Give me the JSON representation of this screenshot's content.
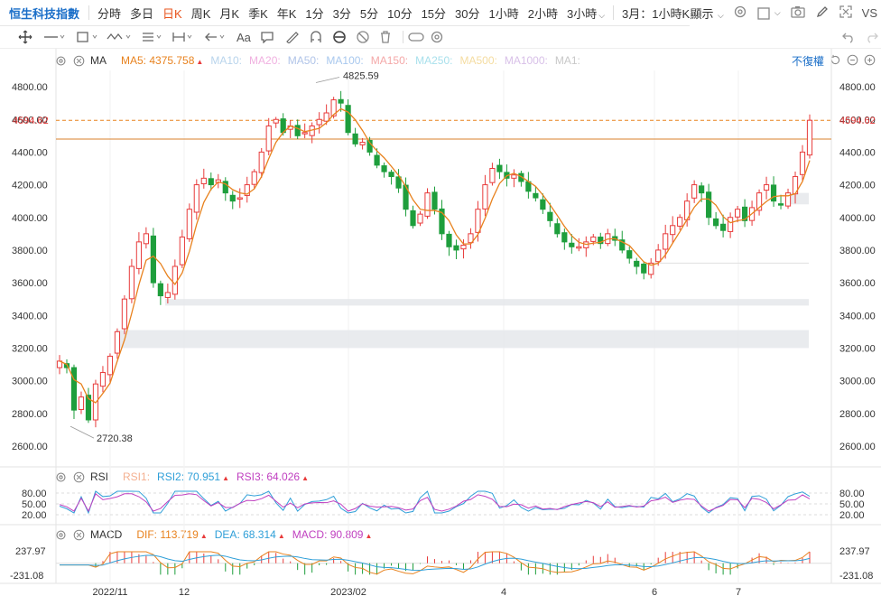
{
  "timeframe_bar": {
    "title": "恒生科技指數",
    "items": [
      "分時",
      "多日",
      "日K",
      "周K",
      "月K",
      "季K",
      "年K",
      "1分",
      "3分",
      "5分",
      "10分",
      "15分",
      "30分",
      "1小時",
      "2小時",
      "3小時"
    ],
    "active": "日K",
    "range_select": "3月：1小時K",
    "display_label": "顯示",
    "vs_label": "VS"
  },
  "main_panel": {
    "indicator": "MA",
    "ma_items": [
      {
        "label": "MA5:",
        "value": "4375.758",
        "color": "#e8821e",
        "up": true
      },
      {
        "label": "MA10:",
        "value": "",
        "color": "#b8d4ec",
        "up": false
      },
      {
        "label": "MA20:",
        "value": "",
        "color": "#f0b0e0",
        "up": false
      },
      {
        "label": "MA50:",
        "value": "",
        "color": "#b0c4e8",
        "up": false
      },
      {
        "label": "MA100:",
        "value": "",
        "color": "#a8c8ee",
        "up": false
      },
      {
        "label": "MA150:",
        "value": "",
        "color": "#f4a8a8",
        "up": false
      },
      {
        "label": "MA250:",
        "value": "",
        "color": "#a8e0ec",
        "up": false
      },
      {
        "label": "MA500:",
        "value": "",
        "color": "#f4dca0",
        "up": false
      },
      {
        "label": "MA1000:",
        "value": "",
        "color": "#d8c0e8",
        "up": false
      },
      {
        "label": "MA1:",
        "value": "",
        "color": "#c8c8c8",
        "up": false
      }
    ],
    "adjust_label": "不復權",
    "y_ticks": [
      "4800.00",
      "4600.00",
      "4400.00",
      "4200.00",
      "4000.00",
      "3800.00",
      "3600.00",
      "3400.00",
      "3200.00",
      "3000.00",
      "2800.00",
      "2600.00"
    ],
    "current_price": "4594.62",
    "high_label": "4825.59",
    "low_label": "2720.38"
  },
  "rsi_panel": {
    "indicator": "RSI",
    "items": [
      {
        "label": "RSI1:",
        "value": "",
        "color": "#f4b090",
        "up": false
      },
      {
        "label": "RSI2:",
        "value": "70.951",
        "color": "#2f9fd8",
        "up": true
      },
      {
        "label": "RSI3:",
        "value": "64.026",
        "color": "#c040c0",
        "up": true
      }
    ],
    "y_ticks": [
      "80.00",
      "50.00",
      "20.00"
    ]
  },
  "macd_panel": {
    "indicator": "MACD",
    "items": [
      {
        "label": "DIF:",
        "value": "113.719",
        "color": "#e8821e",
        "up": true
      },
      {
        "label": "DEA:",
        "value": "68.314",
        "color": "#2f9fd8",
        "up": true
      },
      {
        "label": "MACD:",
        "value": "90.809",
        "color": "#c040c0",
        "up": true
      }
    ],
    "y_ticks": [
      "237.97",
      "-231.08"
    ]
  },
  "x_axis": {
    "labels": [
      "2022/11",
      "12",
      "2023/02",
      "4",
      "6",
      "7"
    ]
  },
  "colors": {
    "up": "#e83b3b",
    "down": "#1e9e3c",
    "ma5": "#e8821e",
    "accent": "#1a6ec8",
    "active_tab": "#e8541e"
  },
  "chart_data": {
    "type": "candlestick",
    "title": "恒生科技指數",
    "ylim": [
      2500,
      4900
    ],
    "y_ticks": [
      4800,
      4600,
      4400,
      4200,
      4000,
      3800,
      3600,
      3400,
      3200,
      3000,
      2800,
      2600
    ],
    "x_labels": [
      "2022/11",
      "12",
      "2023/02",
      "4",
      "6",
      "7"
    ],
    "close_path": [
      3120,
      3080,
      2820,
      2900,
      2760,
      2980,
      3050,
      3150,
      3300,
      3500,
      3700,
      3850,
      3900,
      3600,
      3520,
      3540,
      3700,
      3880,
      4050,
      4200,
      4240,
      4200,
      4230,
      4150,
      4100,
      4120,
      4200,
      4280,
      4400,
      4560,
      4600,
      4520,
      4560,
      4500,
      4520,
      4560,
      4600,
      4640,
      4720,
      4700,
      4520,
      4450,
      4460,
      4400,
      4320,
      4280,
      4250,
      4180,
      4050,
      3950,
      4020,
      4150,
      4050,
      3900,
      3820,
      3800,
      3830,
      3900,
      4050,
      4200,
      4300,
      4280,
      4240,
      4260,
      4220,
      4160,
      4120,
      4050,
      3980,
      3900,
      3850,
      3820,
      3820,
      3850,
      3880,
      3840,
      3900,
      3860,
      3800,
      3750,
      3700,
      3660,
      3720,
      3800,
      3900,
      3950,
      4000,
      4100,
      4200,
      4150,
      4000,
      3950,
      3920,
      4000,
      4050,
      3980,
      4060,
      4150,
      4200,
      4100,
      4080,
      4150,
      4250,
      4400,
      4594.62
    ],
    "ma5_last": 4375.758,
    "current_price": 4594.62,
    "high": {
      "value": 4825.59,
      "label": "4825.59"
    },
    "low": {
      "value": 2720.38,
      "label": "2720.38"
    },
    "horizontal_line": 4480,
    "zones": [
      [
        3460,
        3500
      ],
      [
        3200,
        3310
      ],
      [
        4080,
        4150
      ]
    ],
    "rsi": {
      "ylim": [
        0,
        100
      ],
      "y_ticks": [
        80,
        50,
        20
      ],
      "rsi2_last": 70.951,
      "rsi3_last": 64.026
    },
    "macd": {
      "ylim": [
        -231.08,
        237.97
      ],
      "y_ticks": [
        237.97,
        -231.08
      ],
      "dif_last": 113.719,
      "dea_last": 68.314,
      "macd_last": 90.809
    }
  }
}
